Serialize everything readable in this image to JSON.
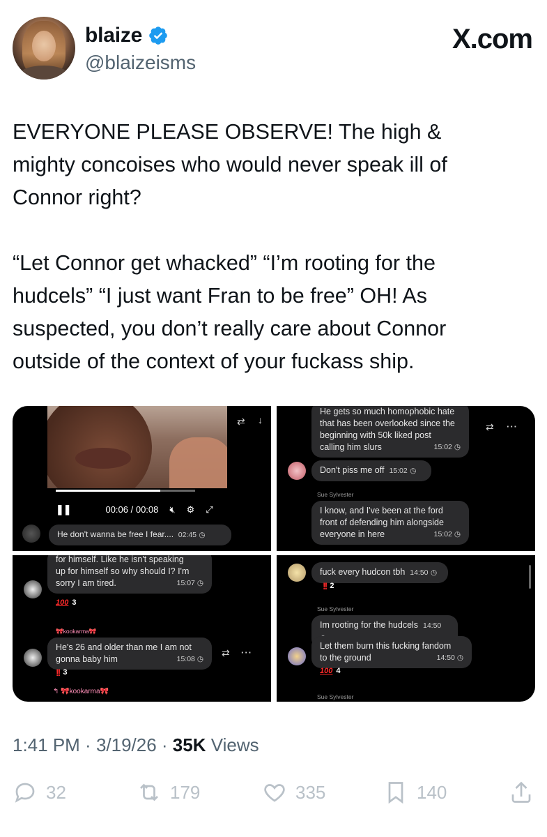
{
  "author": {
    "name": "blaize",
    "handle": "@blaizeisms",
    "brand": "X.com"
  },
  "tweet": {
    "paragraph1": "EVERYONE PLEASE OBSERVE! The high &\nmighty concoises who would never speak ill of\nConnor right?",
    "paragraph2": "“Let Connor get whacked” “I’m rooting for the\nhudcels” “I just want Fran to be free” OH! As\nsuspected, you don’t really care about Connor\noutside of the context of your fuckass ship."
  },
  "media": {
    "c1": {
      "time": "00:06 / 00:08",
      "message": "He don't wanna be free I fear....",
      "message_time": "02:45"
    },
    "c2": {
      "top_message_l1": "He gets so much homophobic hate",
      "top_message_l2": "that has been overlooked since the",
      "top_message_l3": "beginning with 50k liked post",
      "top_message_l4": "calling him slurs",
      "top_time": "15:02",
      "m2": "Don't piss me off",
      "m2_time": "15:02",
      "sender": "Sue Sylvester",
      "m3_l1": "I know, and I've been at the ford",
      "m3_l2": "front of defending him alongside",
      "m3_l3": "everyone in here",
      "m3_time": "15:02"
    },
    "c3": {
      "m1_l1": "for himself. Like he isn't speaking",
      "m1_l2": "up for himself so why should I? I'm",
      "m1_l3": "sorry I am tired.",
      "m1_time": "15:07",
      "badge1_count": "3",
      "sender": "kookarma",
      "m2_l1": "He's 26 and older than me I am not",
      "m2_l2": "gonna baby him",
      "m2_time": "15:08",
      "badge2_count": "3",
      "reply_sender": "kookarma"
    },
    "c4": {
      "m1": "fuck every hudcon tbh",
      "m1_time": "14:50",
      "badge1_count": "2",
      "sender": "Sue Sylvester",
      "m2": "Im rooting for the hudcels",
      "m2_time": "14:50",
      "m3_l1": "Let them burn this fucking fandom",
      "m3_l2": "to the ground",
      "m3_time": "14:50",
      "badge3_count": "4",
      "bottom_sender": "Sue Sylvester"
    }
  },
  "meta": {
    "time": "1:41 PM",
    "sep": " · ",
    "date": "3/19/26",
    "views_count": "35K",
    "views_label": " Views"
  },
  "actions": {
    "replies": "32",
    "reposts": "179",
    "likes": "335",
    "bookmarks": "140"
  },
  "colors": {
    "verified": "#1d9bf0",
    "text": "#0f1419",
    "muted": "#536471",
    "action_gray": "#b9c1c8"
  },
  "media_progress_fraction": 0.75
}
